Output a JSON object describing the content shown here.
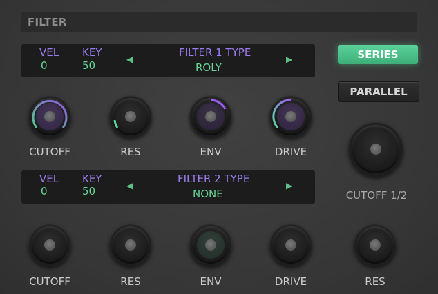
{
  "section": {
    "title": "FILTER"
  },
  "filter1": {
    "vel_label": "VEL",
    "vel_value": "0",
    "key_label": "KEY",
    "key_value": "50",
    "type_label": "FILTER 1 TYPE",
    "type_value": "ROLY",
    "prev_arrow": "◀",
    "next_arrow": "▶"
  },
  "filter2": {
    "vel_label": "VEL",
    "vel_value": "0",
    "key_label": "KEY",
    "key_value": "50",
    "type_label": "FILTER 2 TYPE",
    "type_value": "NONE",
    "prev_arrow": "◀",
    "next_arrow": "▶"
  },
  "routing": {
    "series_label": "SERIES",
    "parallel_label": "PARALLEL",
    "selected": "SERIES"
  },
  "knobs_row1": {
    "cutoff": "CUTOFF",
    "res": "RES",
    "env": "ENV",
    "drive": "DRIVE"
  },
  "knobs_row2": {
    "cutoff": "CUTOFF",
    "res": "RES",
    "env": "ENV",
    "drive": "DRIVE",
    "res2": "RES"
  },
  "cutoff_mix": {
    "label": "CUTOFF 1/2"
  },
  "colors": {
    "accent_purple": "#9c7cf0",
    "accent_green": "#67d697",
    "series_active": "#4fc48b"
  }
}
